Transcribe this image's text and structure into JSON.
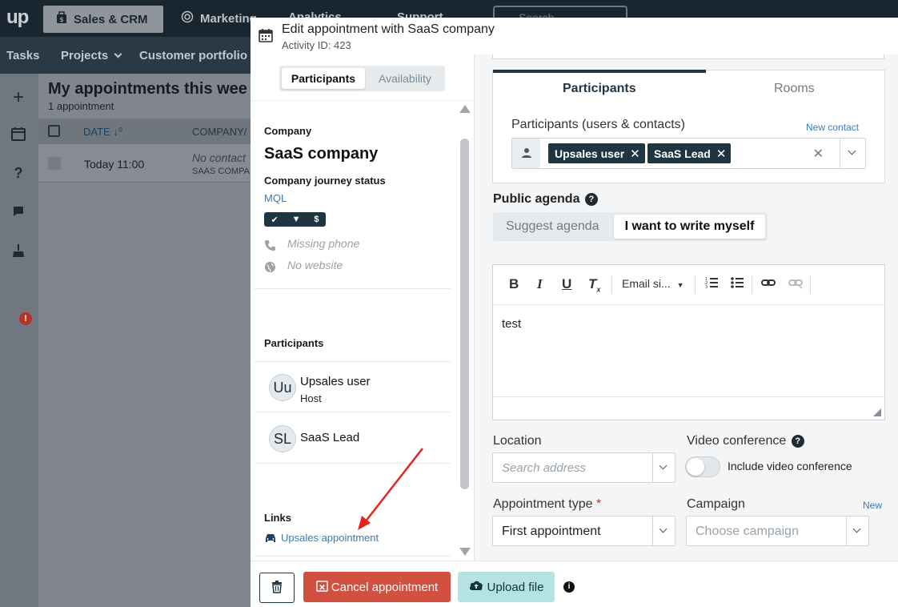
{
  "app": {
    "logo": "up",
    "nav_tabs": [
      "Sales & CRM",
      "Marketing",
      "Analytics",
      "Support"
    ],
    "search_placeholder": "Search",
    "sub_nav": [
      "Tasks",
      "Projects",
      "Customer portfolio"
    ],
    "sidebar_badge": "!"
  },
  "background_page": {
    "title": "My appointments this wee",
    "subtitle": "1 appointment",
    "col_date": "DATE",
    "col_company": "COMPANY/",
    "row_date": "Today 11:00",
    "row_contact": "No contact",
    "row_company": "SAAS COMPA"
  },
  "modal": {
    "title": "Edit appointment with SaaS company",
    "activity_id": "Activity ID: 423"
  },
  "left_panel": {
    "tabs": [
      "Participants",
      "Availability"
    ],
    "company_label": "Company",
    "company_name": "SaaS company",
    "journey_label": "Company journey status",
    "journey_value": "MQL",
    "journey_icons": [
      "✔",
      "▼",
      "$"
    ],
    "phone": "Missing phone",
    "website": "No website",
    "participants_label": "Participants",
    "participants": [
      {
        "initials": "Uu",
        "name": "Upsales user",
        "role": "Host"
      },
      {
        "initials": "SL",
        "name": "SaaS Lead",
        "role": ""
      }
    ],
    "links_label": "Links",
    "link_text": "Upsales appointment"
  },
  "right_panel": {
    "tabs": [
      "Participants",
      "Rooms"
    ],
    "participants_field_label": "Participants (users & contacts)",
    "new_contact": "New contact",
    "chips": [
      "Upsales user",
      "SaaS Lead"
    ],
    "public_agenda_label": "Public agenda",
    "agenda_options": [
      "Suggest agenda",
      "I want to write myself"
    ],
    "editor": {
      "font_select": "Email si...",
      "content": "test"
    },
    "location_label": "Location",
    "location_placeholder": "Search address",
    "video_label": "Video conference",
    "video_toggle_label": "Include video conference",
    "video_enabled": false,
    "type_label": "Appointment type",
    "type_value": "First appointment",
    "campaign_label": "Campaign",
    "campaign_new": "New",
    "campaign_placeholder": "Choose campaign"
  },
  "footer": {
    "cancel_label": "Cancel appointment",
    "upload_label": "Upload file"
  },
  "colors": {
    "dark_navy": "#1f3541",
    "danger": "#d2503f",
    "upload_bg": "#b4e3e2",
    "link": "#3a7ab8",
    "annotation": "#e0261f"
  }
}
